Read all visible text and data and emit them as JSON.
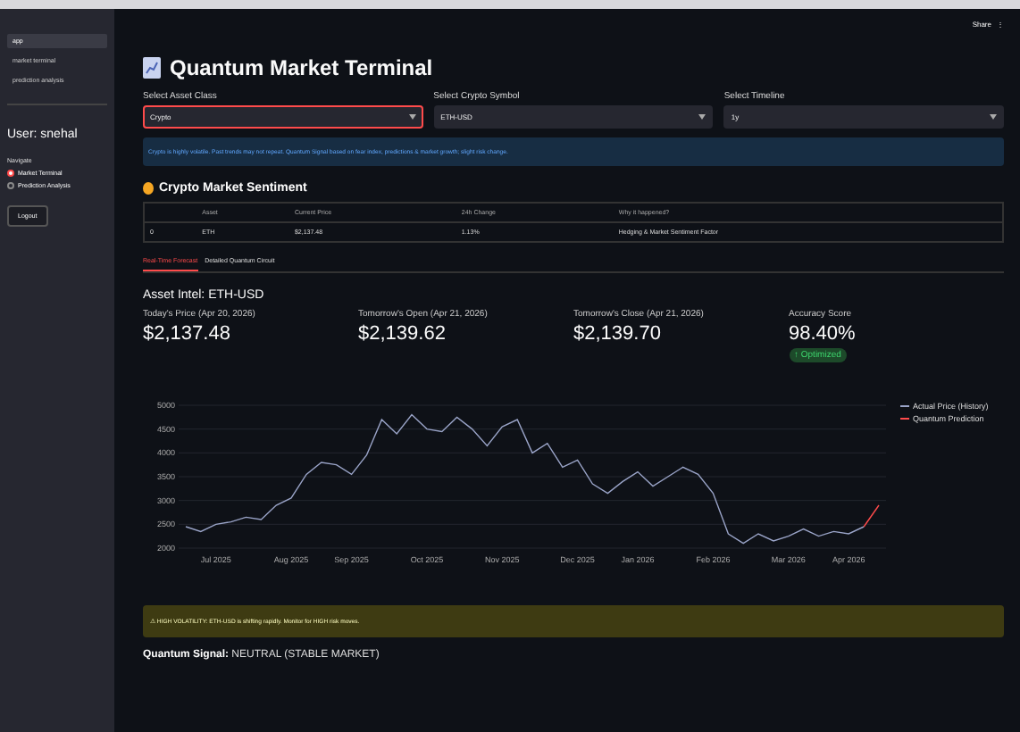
{
  "sidebar": {
    "pages": [
      {
        "label": "app",
        "selected": true
      },
      {
        "label": "market terminal",
        "selected": false
      },
      {
        "label": "prediction analysis",
        "selected": false
      }
    ],
    "user": "User: snehal",
    "nav_label": "Navigate",
    "nav_options": [
      {
        "label": "Market Terminal",
        "selected": true
      },
      {
        "label": "Prediction Analysis",
        "selected": false
      }
    ],
    "logout": "Logout"
  },
  "header": {
    "share": "Share",
    "menu": "⋮"
  },
  "title": "Quantum Market Terminal",
  "selects": [
    {
      "label": "Select Asset Class",
      "value": "Crypto",
      "focused": true
    },
    {
      "label": "Select Crypto Symbol",
      "value": "ETH-USD",
      "focused": false
    },
    {
      "label": "Select Timeline",
      "value": "1y",
      "focused": false
    }
  ],
  "info": "Crypto is highly volatile. Past trends may not repeat. Quantum Signal based on fear index, predictions & market growth; slight risk change.",
  "sentiment": {
    "title": "Crypto Market Sentiment",
    "columns": [
      "",
      "Asset",
      "Current Price",
      "24h Change",
      "Why it happened?"
    ],
    "rows": [
      [
        "0",
        "ETH",
        "$2,137.48",
        "1.13%",
        "Hedging & Market Sentiment Factor"
      ]
    ]
  },
  "tabs": [
    {
      "label": "Real-Time Forecast",
      "selected": true
    },
    {
      "label": "Detailed Quantum Circuit",
      "selected": false
    }
  ],
  "asset_title": "Asset Intel: ETH-USD",
  "metrics": [
    {
      "label": "Today's Price (Apr 20, 2026)",
      "value": "$2,137.48"
    },
    {
      "label": "Tomorrow's Open (Apr 21, 2026)",
      "value": "$2,139.62"
    },
    {
      "label": "Tomorrow's Close (Apr 21, 2026)",
      "value": "$2,139.70"
    },
    {
      "label": "Accuracy Score",
      "value": "98.40%",
      "badge": "↑ Optimized"
    }
  ],
  "chart": {
    "chart_data": {
      "type": "line",
      "categories": [
        null,
        null,
        "Jul 2025",
        null,
        null,
        null,
        null,
        "Aug 2025",
        null,
        null,
        null,
        "Sep 2025",
        null,
        null,
        null,
        null,
        "Oct 2025",
        null,
        null,
        null,
        null,
        "Nov 2025",
        null,
        null,
        null,
        null,
        "Dec 2025",
        null,
        null,
        null,
        "Jan 2026",
        null,
        null,
        null,
        null,
        "Feb 2026",
        null,
        null,
        null,
        null,
        "Mar 2026",
        null,
        null,
        null,
        "Apr 2026",
        null,
        null
      ],
      "series": [
        {
          "name": "Actual Price (History)",
          "color": "#9aa4c8",
          "values": [
            2450,
            2350,
            2500,
            2550,
            2650,
            2600,
            2900,
            3050,
            3550,
            3800,
            3750,
            3550,
            3950,
            4700,
            4400,
            4800,
            4500,
            4450,
            4750,
            4500,
            4150,
            4550,
            4700,
            4000,
            4200,
            3700,
            3850,
            3350,
            3150,
            3400,
            3600,
            3300,
            3500,
            3700,
            3550,
            3150,
            2300,
            2100,
            2300,
            2150,
            2250,
            2400,
            2250,
            2350,
            2300,
            2450,
            null
          ]
        },
        {
          "name": "Quantum Prediction",
          "color": "#ff4b4b",
          "values": [
            null,
            null,
            null,
            null,
            null,
            null,
            null,
            null,
            null,
            null,
            null,
            null,
            null,
            null,
            null,
            null,
            null,
            null,
            null,
            null,
            null,
            null,
            null,
            null,
            null,
            null,
            null,
            null,
            null,
            null,
            null,
            null,
            null,
            null,
            null,
            null,
            null,
            null,
            null,
            null,
            null,
            null,
            null,
            null,
            null,
            2450,
            2900
          ]
        }
      ],
      "grid": true,
      "ylim": [
        2000,
        5000
      ],
      "yticks": [
        2000,
        2500,
        3000,
        3500,
        4000,
        4500,
        5000
      ]
    }
  },
  "warning": "⚠ HIGH VOLATILITY: ETH-USD is shifting rapidly. Monitor for HIGH risk moves.",
  "signal": "**Quantum Signal:** NEUTRAL (STABLE MARKET)"
}
